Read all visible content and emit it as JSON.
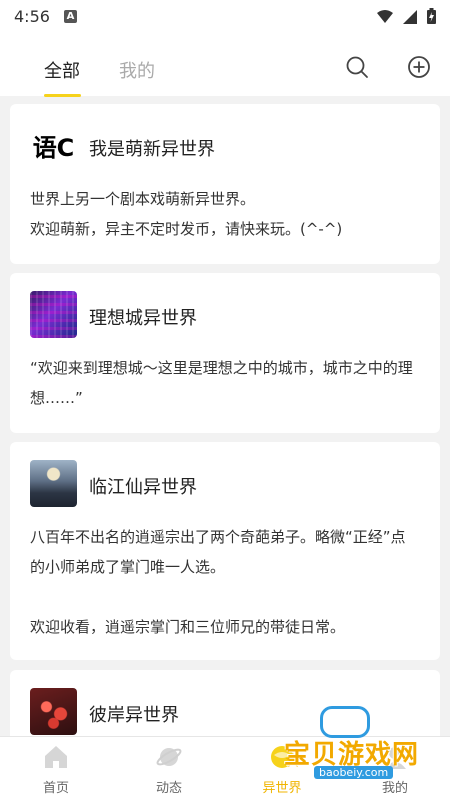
{
  "status_bar": {
    "time": "4:56",
    "app_badge": "A"
  },
  "header": {
    "tabs": [
      {
        "label": "全部",
        "active": true
      },
      {
        "label": "我的",
        "active": false
      }
    ],
    "accent_color": "#f6d21b"
  },
  "worlds": [
    {
      "avatar_text": "语C",
      "title": "我是萌新异世界",
      "description": "世界上另一个剧本戏萌新异世界。\n欢迎萌新，异主不定时发币，请快来玩。(^-^)"
    },
    {
      "title": "理想城异世界",
      "description": "“欢迎来到理想城～这里是理想之中的城市，城市之中的理想……”"
    },
    {
      "title": "临江仙异世界",
      "description": "八百年不出名的逍遥宗出了两个奇葩弟子。略微“正经”点的小师弟成了掌门唯一人选。\n\n欢迎收看，逍遥宗掌门和三位师兄的带徒日常。"
    },
    {
      "title": "彼岸异世界",
      "description": ""
    }
  ],
  "bottom_nav": {
    "items": [
      {
        "label": "首页",
        "icon": "home-icon"
      },
      {
        "label": "动态",
        "icon": "planet-icon"
      },
      {
        "label": "异世界",
        "icon": "world-icon",
        "active": true
      },
      {
        "label": "我的",
        "icon": "profile-icon"
      }
    ],
    "active_color": "#f0b400"
  },
  "watermark": {
    "text": "宝贝游戏网",
    "url": "baobeiy.com"
  }
}
